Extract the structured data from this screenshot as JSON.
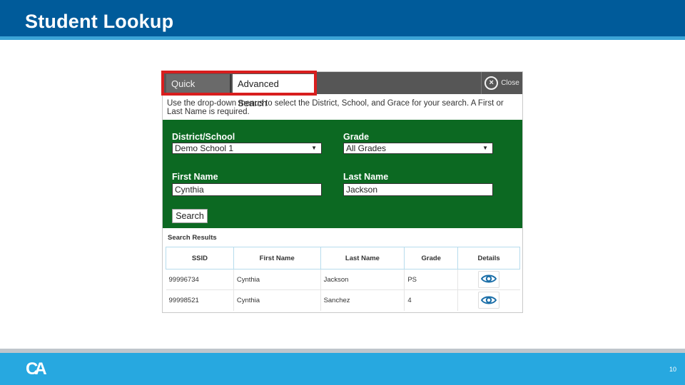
{
  "slide": {
    "title": "Student Lookup",
    "page_number": "10",
    "logo_text": "CA"
  },
  "panel": {
    "tabs": [
      {
        "label": "Quick Search",
        "active": false
      },
      {
        "label": "Advanced Search",
        "active": true
      }
    ],
    "highlight_color": "#d81e1e",
    "close_label": "Close",
    "instructions": "Use the drop-down menus to select the District, School, and Grace for your search. A First or Last Name is required.",
    "form": {
      "district_label": "District/School",
      "district_value": "Demo School 1",
      "grade_label": "Grade",
      "grade_value": "All Grades",
      "first_name_label": "First Name",
      "first_name_value": "Cynthia",
      "last_name_label": "Last Name",
      "last_name_value": "Jackson",
      "search_label": "Search",
      "background_color": "#0c6922"
    },
    "results": {
      "title": "Search Results",
      "columns": [
        "SSID",
        "First Name",
        "Last Name",
        "Grade",
        "Details"
      ],
      "rows": [
        {
          "ssid": "99996734",
          "first": "Cynthia",
          "last": "Jackson",
          "grade": "PS",
          "details_icon": "eye-icon"
        },
        {
          "ssid": "99998521",
          "first": "Cynthia",
          "last": "Sanchez",
          "grade": "4",
          "details_icon": "eye-icon"
        }
      ]
    }
  },
  "colors": {
    "header": "#005b9a",
    "header_stripe": "#3ba4d6",
    "footer": "#27a8e0",
    "eye_icon": "#1a6ea8"
  }
}
